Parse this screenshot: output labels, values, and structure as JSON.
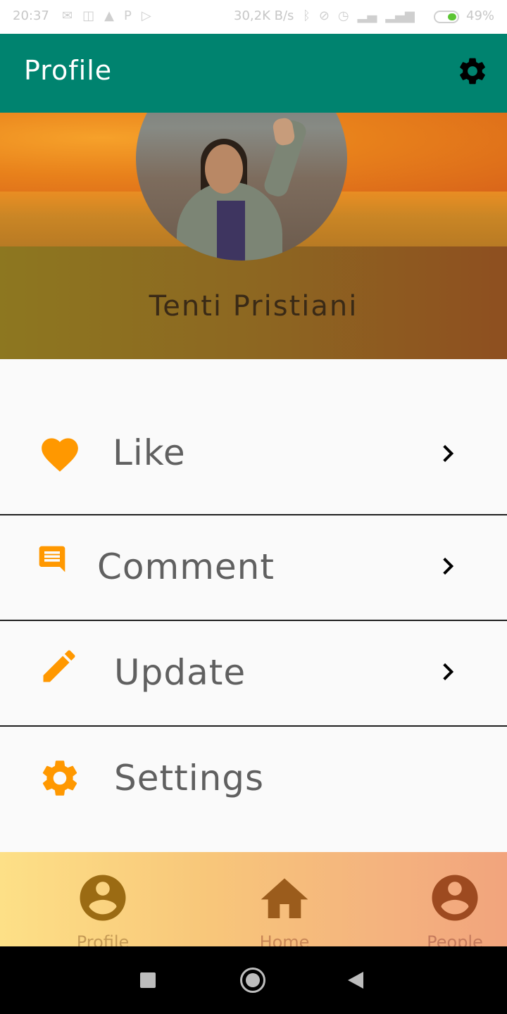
{
  "status_bar": {
    "time": "20:37",
    "network_speed": "30,2K B/s",
    "battery": "49%",
    "icons_left": [
      "mail-icon",
      "instagram-icon",
      "warning-icon",
      "p-icon",
      "play-icon"
    ],
    "icons_right": [
      "bluetooth-icon",
      "mute-icon",
      "alarm-icon",
      "wifi-signal-icon",
      "signal-icon"
    ]
  },
  "app_bar": {
    "title": "Profile",
    "settings_icon": "gear-icon",
    "background": "#00836f"
  },
  "profile": {
    "name": "Tenti Pristiani"
  },
  "menu": {
    "items": [
      {
        "label": "Like",
        "icon": "heart-icon",
        "has_chevron": true
      },
      {
        "label": "Comment",
        "icon": "comment-icon",
        "has_chevron": true
      },
      {
        "label": "Update",
        "icon": "pencil-icon",
        "has_chevron": true
      },
      {
        "label": "Settings",
        "icon": "gear-icon",
        "has_chevron": false
      }
    ],
    "icon_color": "#ff9800"
  },
  "bottom_nav": {
    "items": [
      {
        "label": "Profile",
        "icon": "account-circle-icon",
        "color": "#9b6b13"
      },
      {
        "label": "Home",
        "icon": "home-icon",
        "color": "#9b5c1c"
      },
      {
        "label": "People",
        "icon": "account-circle-icon",
        "color": "#9d4a20"
      }
    ]
  }
}
